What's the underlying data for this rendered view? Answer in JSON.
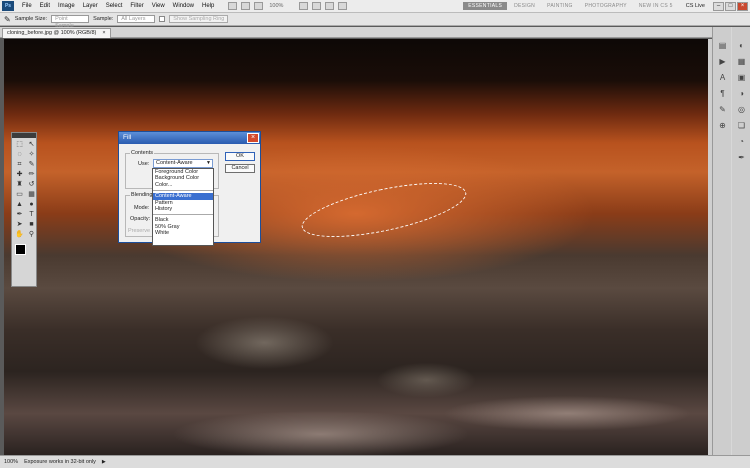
{
  "menubar": {
    "logo": "Ps",
    "items": [
      "File",
      "Edit",
      "Image",
      "Layer",
      "Select",
      "Filter",
      "View",
      "Window",
      "Help"
    ],
    "zoom": "100%",
    "workspaces": [
      "ESSENTIALS",
      "DESIGN",
      "PAINTING",
      "PHOTOGRAPHY",
      "NEW IN CS 5"
    ],
    "active_workspace": "ESSENTIALS",
    "cs_live": "CS Live"
  },
  "options": {
    "sample_size_label": "Sample Size:",
    "sample_size_value": "Point Sample",
    "sample_label": "Sample:",
    "sample_value": "All Layers",
    "sampling_ring_label": "Show Sampling Ring"
  },
  "document": {
    "tab": "cloning_before.jpg @ 100% (RGB/8)",
    "close": "×"
  },
  "dialog": {
    "title": "Fill",
    "contents_label": "Contents",
    "use_label": "Use:",
    "use_value": "Content-Aware",
    "blending_label": "Blending",
    "mode_label": "Mode:",
    "opacity_label": "Opacity:",
    "preserve_label": "Preserve",
    "ok": "OK",
    "cancel": "Cancel",
    "use_options_top": [
      "Foreground Color",
      "Background Color",
      "Color..."
    ],
    "use_options_mid": [
      "Content-Aware",
      "Pattern",
      "History"
    ],
    "use_options_bottom": [
      "Black",
      "50% Gray",
      "White"
    ]
  },
  "status": {
    "zoom": "100%",
    "info": "Exposure works in 32-bit only"
  },
  "colors": {
    "accent": "#3a6fd0",
    "foreground": "#000000",
    "background": "#ffffff"
  }
}
